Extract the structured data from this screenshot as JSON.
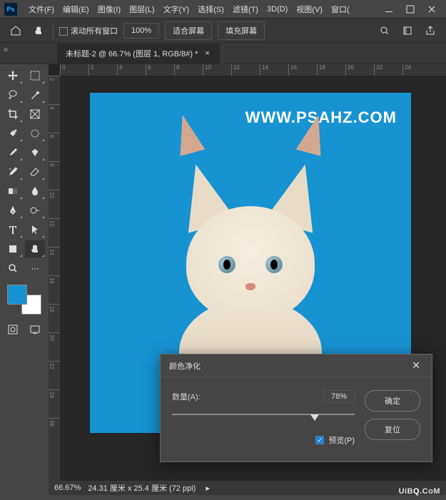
{
  "menu": [
    "文件(F)",
    "编辑(E)",
    "图像(I)",
    "图层(L)",
    "文字(Y)",
    "选择(S)",
    "滤镜(T)",
    "3D(D)",
    "视图(V)",
    "窗口("
  ],
  "toolbar": {
    "scroll_all": "滚动所有窗口",
    "zoom": "100%",
    "fit_screen": "适合屏幕",
    "fill_screen": "填充屏幕"
  },
  "tab": {
    "title": "未标题-2 @ 66.7% (图层 1, RGB/8#) *"
  },
  "ruler_h": [
    "0",
    "2",
    "4",
    "6",
    "8",
    "10",
    "12",
    "14",
    "16",
    "18",
    "20",
    "22",
    "24"
  ],
  "ruler_v": [
    "2",
    "4",
    "6",
    "8",
    "10",
    "12",
    "14",
    "16",
    "18",
    "20",
    "22",
    "24",
    "26"
  ],
  "canvas": {
    "watermark": "WWW.PSAHZ.COM"
  },
  "dialog": {
    "title": "颜色净化",
    "amount_label": "数量(A):",
    "amount_value": "78%",
    "ok": "确定",
    "reset": "复位",
    "preview": "预览(P)"
  },
  "status": {
    "zoom": "66.67%",
    "doc": "24.31 厘米 x 25.4 厘米 (72 ppi)"
  },
  "watermark": {
    "a": "UiB",
    "b": "Q.",
    "c": "CoM"
  },
  "colors": {
    "fg": "#1793d2",
    "bg": "#ffffff"
  }
}
